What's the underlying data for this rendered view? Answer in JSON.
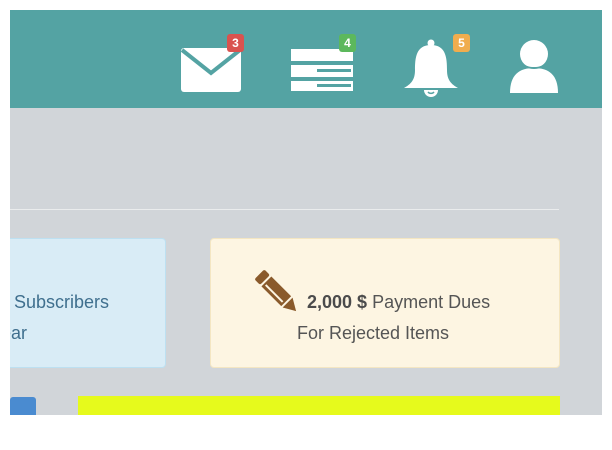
{
  "topbar": {
    "background": "#54a3a3",
    "items": [
      {
        "name": "messages",
        "icon": "envelope-icon",
        "badge": "3",
        "badge_color": "#d9534f"
      },
      {
        "name": "tasks",
        "icon": "tasks-list-icon",
        "badge": "4",
        "badge_color": "#5cb85c"
      },
      {
        "name": "notifications",
        "icon": "bell-icon",
        "badge": "5",
        "badge_color": "#f0ad4e"
      },
      {
        "name": "user",
        "icon": "user-icon"
      }
    ]
  },
  "cards": {
    "subscribers": {
      "line1": "Subscribers",
      "line2": "ear",
      "background": "#d9ecf6"
    },
    "payment": {
      "icon": "pencil-icon",
      "amount": "2,000 $",
      "label": " Payment Dues",
      "line2": "For Rejected Items",
      "background": "#fdf5e2",
      "icon_color": "#8a5a2b"
    }
  },
  "bottom": {
    "tab_color": "#4a8bd0",
    "bar_color": "#e6fa1c"
  }
}
